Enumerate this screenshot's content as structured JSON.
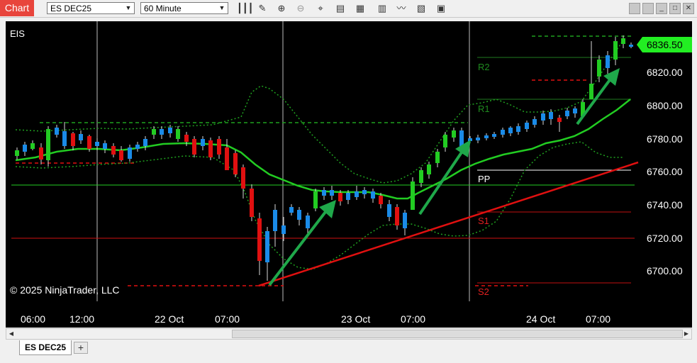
{
  "window": {
    "tab_label": "Chart",
    "instrument_select": "ES DEC25",
    "interval_select": "60 Minute"
  },
  "toolbar_icons": [
    "bars-icon",
    "pencil-icon",
    "zoom-in-icon",
    "zoom-out-icon",
    "crosshair-icon",
    "properties-icon",
    "chart-trader-icon",
    "data-box-icon",
    "indicators-icon",
    "strategies-icon",
    "templates-icon"
  ],
  "chart": {
    "instrument_label": "EIS",
    "copyright": "© 2025 NinjaTrader, LLC",
    "last_price": "6836.50",
    "y_labels": [
      "6820.00",
      "6800.00",
      "6780.00",
      "6760.00",
      "6740.00",
      "6720.00",
      "6700.00"
    ],
    "x_labels": [
      "06:00",
      "12:00",
      "22 Oct",
      "07:00",
      "23 Oct",
      "07:00",
      "24 Oct",
      "07:00"
    ],
    "pivot_labels": [
      "R2",
      "R1",
      "PP",
      "S1",
      "S2"
    ],
    "colors": {
      "up_candle": "#1a8be8",
      "down_candle": "#e01010",
      "up_candle_session2": "#22cc22",
      "ma_line": "#22cc22",
      "bands": "#1fa01f",
      "trendline": "#e01010",
      "arrows": "#1fa84a",
      "last_price_bg": "#22ee22"
    }
  },
  "tabs": {
    "active": "ES DEC25",
    "add_label": "+"
  }
}
